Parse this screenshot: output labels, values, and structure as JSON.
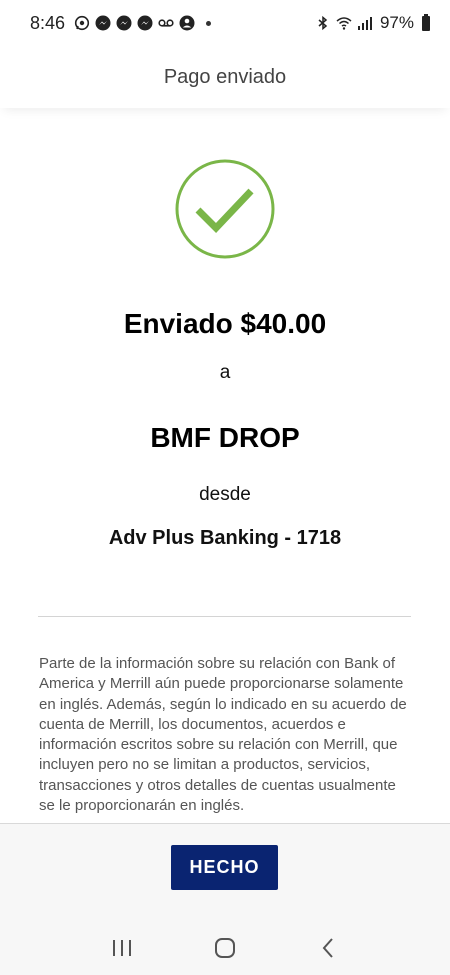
{
  "status_bar": {
    "time": "8:46",
    "battery": "97%",
    "left_icons": [
      "whatsapp-icon",
      "messenger-icon",
      "messenger-icon",
      "messenger-icon",
      "voicemail-icon",
      "account-icon"
    ],
    "right_icons": [
      "bluetooth-icon",
      "wifi-icon",
      "signal-icon",
      "battery-icon"
    ]
  },
  "header": {
    "title": "Pago enviado"
  },
  "confirmation": {
    "sent_amount": "Enviado $40.00",
    "to_word": "a",
    "recipient": "BMF DROP",
    "from_word": "desde",
    "account": "Adv Plus Banking - 1718",
    "check_color": "#7ab648"
  },
  "disclaimer": "Parte de la información sobre su relación con Bank of America y Merrill aún puede proporcionarse solamente en inglés. Además, según lo indicado en su acuerdo de cuenta de Merrill, los documentos, acuerdos e información escritos sobre su relación con Merrill, que incluyen pero no se limitan a productos, servicios, transacciones y otros detalles de cuentas usualmente se le proporcionarán en inglés.",
  "footer": {
    "done_label": "HECHO",
    "button_color": "#0a2471"
  },
  "nav": [
    "recent-apps-icon",
    "home-icon",
    "back-icon"
  ]
}
